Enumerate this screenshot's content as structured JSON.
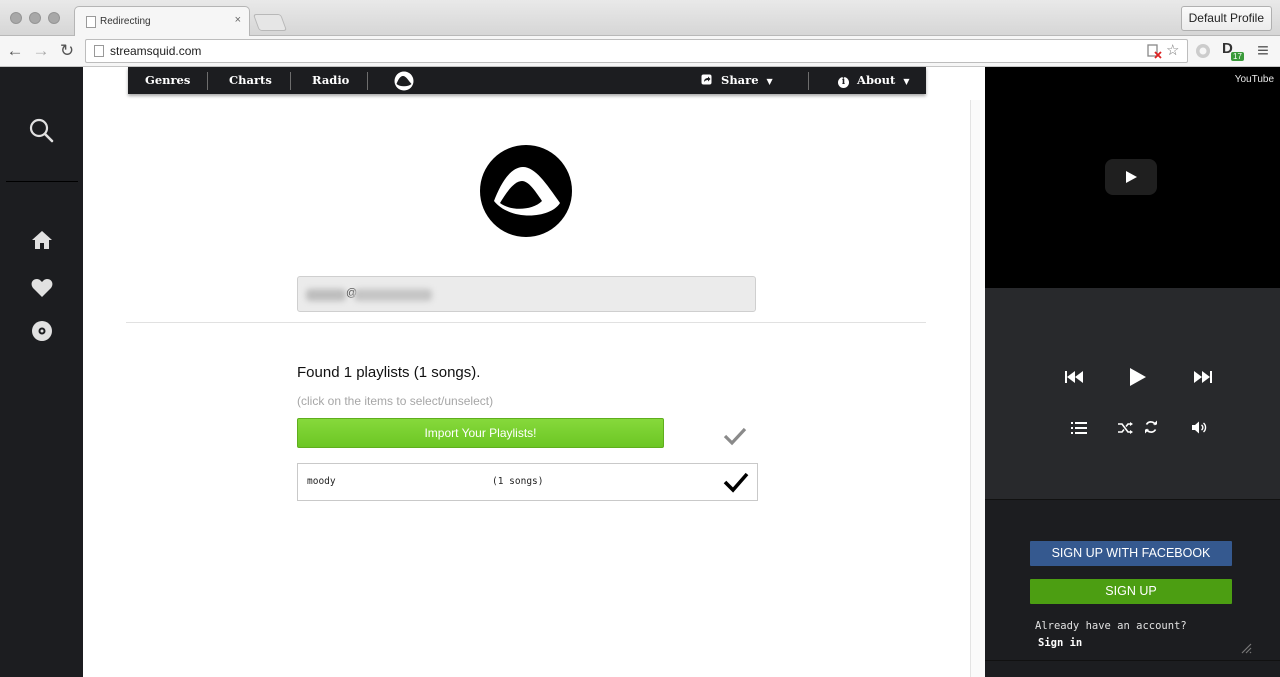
{
  "browser": {
    "tab_title": "Redirecting",
    "tab_close": "×",
    "profile_button": "Default Profile",
    "url": "streamsquid.com",
    "back_glyph": "←",
    "forward_glyph": "→",
    "reload_glyph": "↻",
    "star_glyph": "☆",
    "menu_glyph": "≡",
    "extension_badge": "17",
    "extension_letter": "D"
  },
  "left_sidebar": {
    "icons": [
      "search-icon",
      "home-icon",
      "heart-icon",
      "disc-icon"
    ]
  },
  "topnav": {
    "genres": "Genres",
    "charts": "Charts",
    "radio": "Radio",
    "share": "Share",
    "about": "About",
    "info_glyph": "i"
  },
  "import": {
    "email_at": "@",
    "found_text": "Found 1 playlists (1 songs).",
    "hint": "(click on the items to select/unselect)",
    "import_button": "Import Your Playlists!",
    "playlists": [
      {
        "name": "moody",
        "songs": "(1 songs)",
        "selected": true
      }
    ]
  },
  "player": {
    "youtube_label": "YouTube"
  },
  "auth": {
    "facebook_button": "SIGN UP WITH FACEBOOK",
    "signup_button": "SIGN UP",
    "already_text": "Already have an account?",
    "signin_link": "Sign in"
  },
  "colors": {
    "dark_panel": "#1c1d20",
    "import_green": "#6cc624",
    "facebook_blue": "#35598f",
    "signup_green": "#4c9e12"
  }
}
